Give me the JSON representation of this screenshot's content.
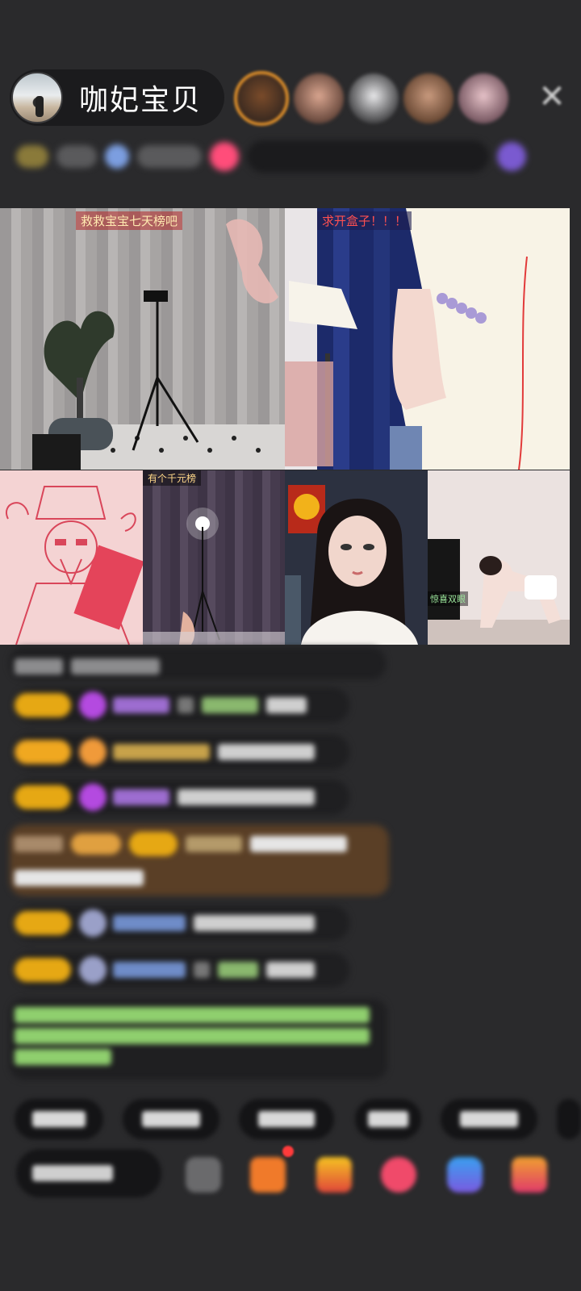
{
  "host": {
    "name": "咖妃宝贝"
  },
  "header": {
    "close_icon": "close-icon"
  },
  "tiles": [
    {
      "caption": "救救宝宝七天榜吧"
    },
    {
      "caption": "求开盒子！！！"
    },
    {
      "caption": "有个千元榜"
    },
    {
      "caption": "惊喜双眼"
    }
  ],
  "colors": {
    "background": "#2a2a2c",
    "level_badge": "#e6a814",
    "accent_pink": "#ff4d7a",
    "chat_bubble": "#1f1f21",
    "chat_highlight": "#5a3f26"
  }
}
